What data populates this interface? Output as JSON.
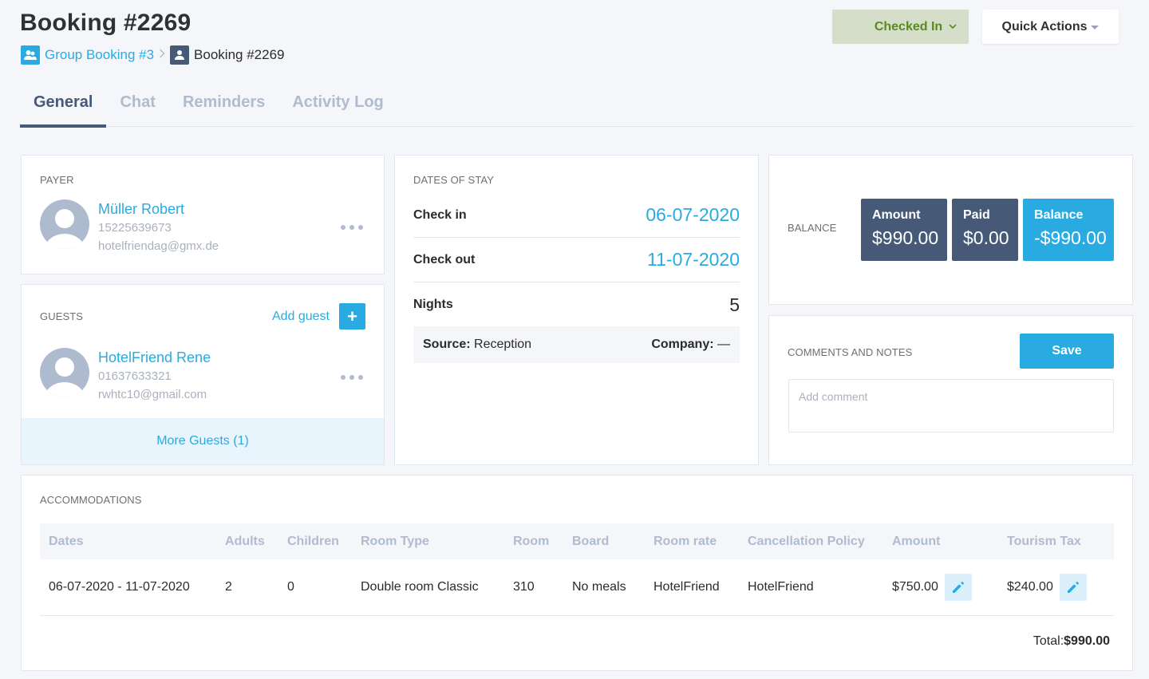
{
  "header": {
    "title": "Booking #2269",
    "breadcrumb": {
      "parent_label": "Group Booking #3",
      "parent_icon": "group-icon",
      "separator": ">",
      "current_label": "Booking #2269",
      "current_icon": "user-icon"
    },
    "status_button": {
      "label": "Checked In",
      "icon": "chevron-down-icon",
      "color": "#5a8a1f",
      "bg": "#d4dec8"
    },
    "quick_actions": {
      "label": "Quick Actions",
      "icon": "caret-down-icon"
    }
  },
  "tabs": [
    {
      "label": "General",
      "active": true
    },
    {
      "label": "Chat",
      "active": false
    },
    {
      "label": "Reminders",
      "active": false
    },
    {
      "label": "Activity Log",
      "active": false
    }
  ],
  "payer": {
    "section_label": "PAYER",
    "name": "Müller Robert",
    "phone": "15225639673",
    "email": "hotelfriendag@gmx.de"
  },
  "guests": {
    "section_label": "GUESTS",
    "add_label": "Add guest",
    "add_icon": "+",
    "list": [
      {
        "name": "HotelFriend Rene",
        "phone": "01637633321",
        "email": "rwhtc10@gmail.com"
      }
    ],
    "more_label": "More Guests (1)"
  },
  "dates_of_stay": {
    "section_label": "DATES OF STAY",
    "check_in_label": "Check in",
    "check_in": "06-07-2020",
    "check_out_label": "Check out",
    "check_out": "11-07-2020",
    "nights_label": "Nights",
    "nights": "5",
    "source_label": "Source:",
    "source": "Reception",
    "company_label": "Company:",
    "company": "—"
  },
  "balance": {
    "section_label": "BALANCE",
    "amount_label": "Amount",
    "amount": "$990.00",
    "paid_label": "Paid",
    "paid": "$0.00",
    "balance_label": "Balance",
    "balance": "-$990.00"
  },
  "comments": {
    "section_label": "COMMENTS AND NOTES",
    "save_label": "Save",
    "placeholder": "Add comment"
  },
  "accommodations": {
    "section_label": "ACCOMMODATIONS",
    "columns": [
      "Dates",
      "Adults",
      "Children",
      "Room Type",
      "Room",
      "Board",
      "Room rate",
      "Cancellation Policy",
      "Amount",
      "Tourism Tax"
    ],
    "rows": [
      {
        "dates": "06-07-2020 - 11-07-2020",
        "adults": "2",
        "children": "0",
        "room_type": "Double room Classic",
        "room": "310",
        "board": "No meals",
        "room_rate": "HotelFriend",
        "cancellation_policy": "HotelFriend",
        "amount": "$750.00",
        "tourism_tax": "$240.00"
      }
    ],
    "total_label": "Total:",
    "total": "$990.00"
  },
  "colors": {
    "accent": "#29abe2",
    "dark": "#465a78",
    "background": "#f4f6fa"
  }
}
